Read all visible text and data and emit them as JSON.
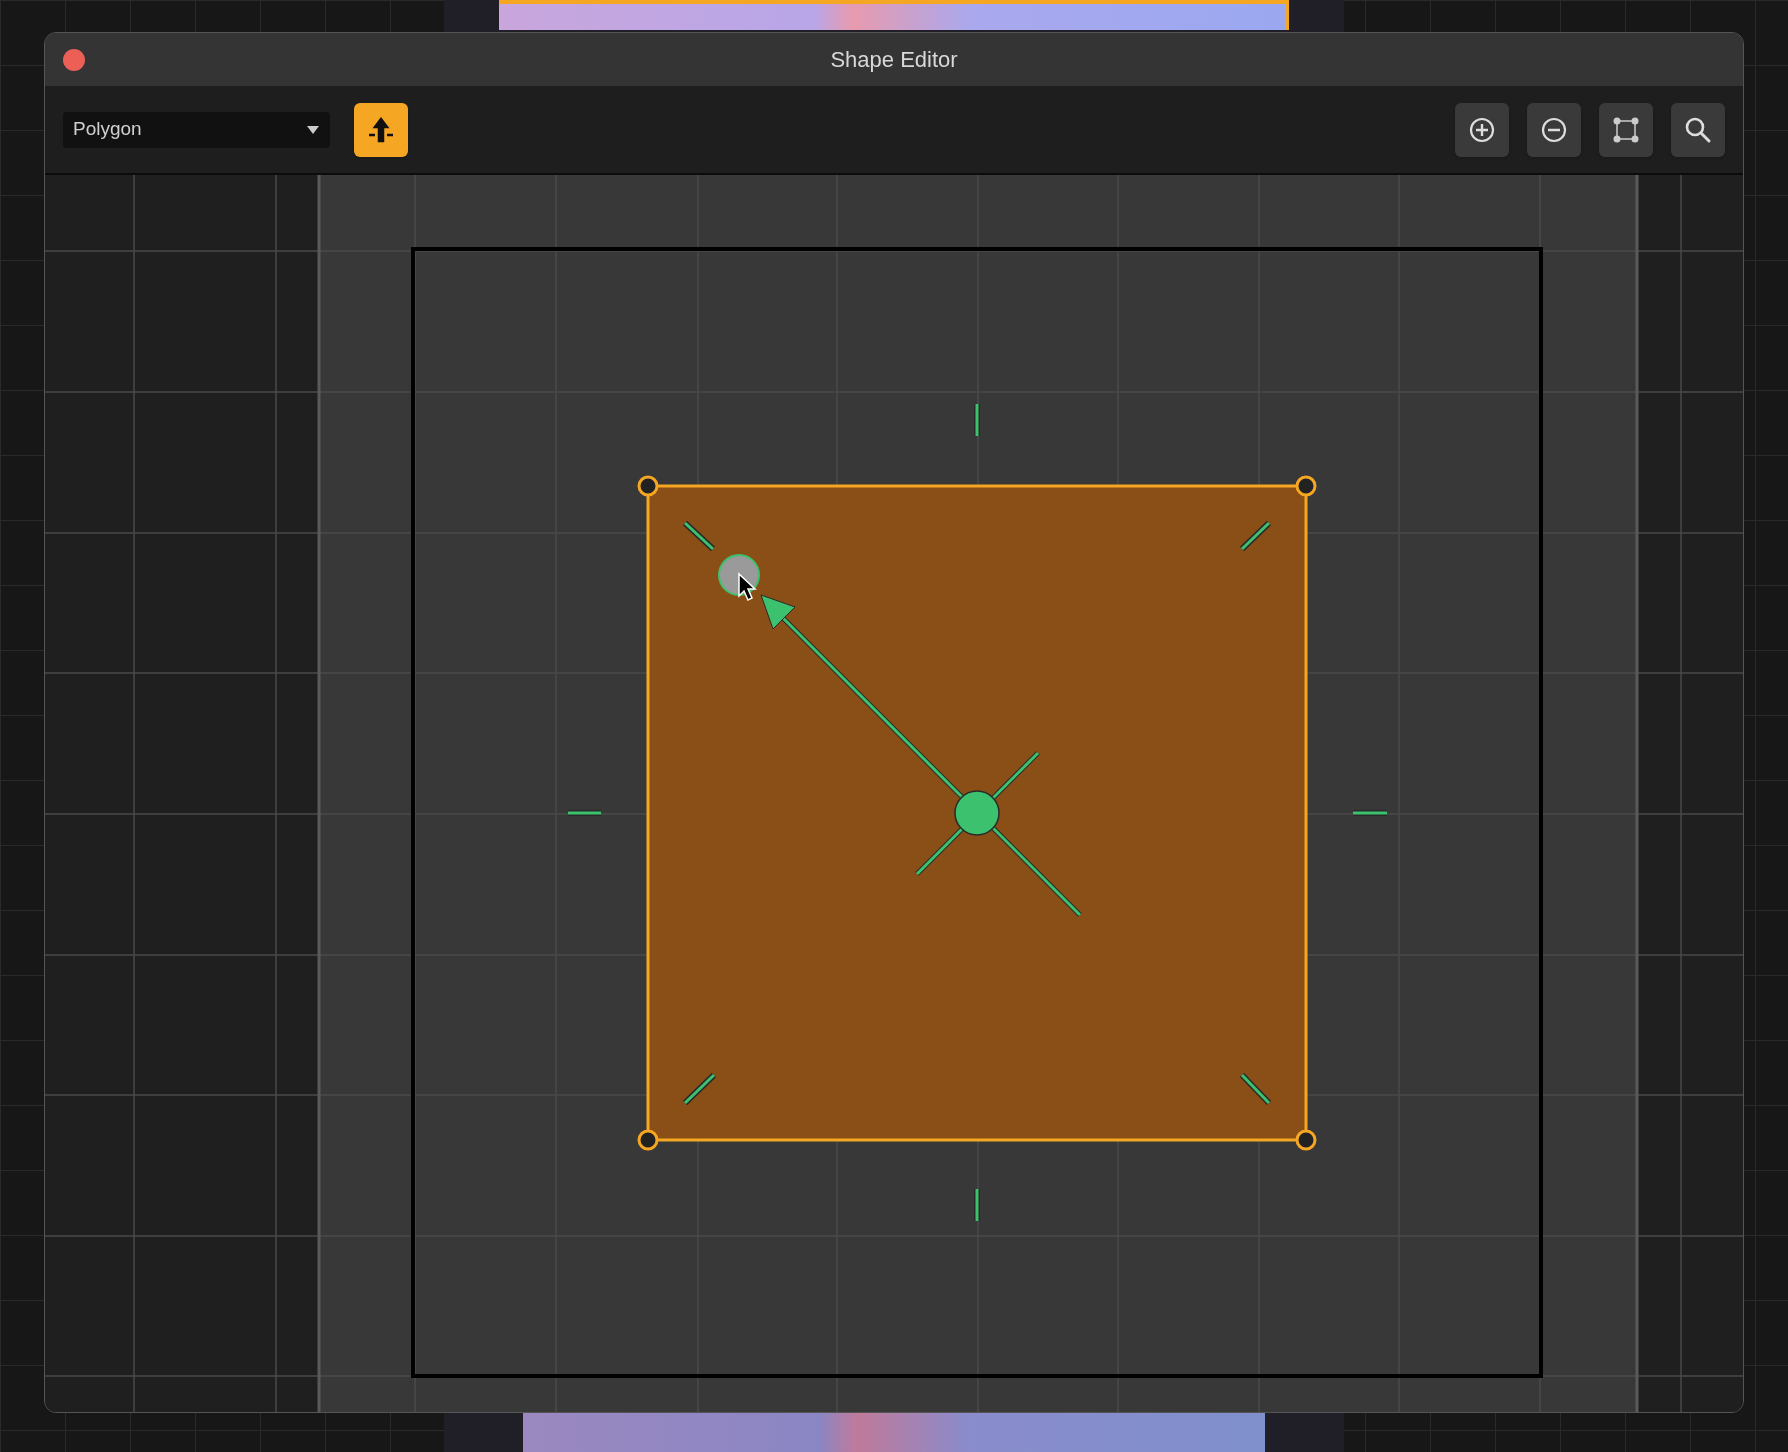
{
  "window": {
    "title": "Shape Editor"
  },
  "toolbar": {
    "shape_type": "Polygon",
    "tools": [
      {
        "kind": "anchor",
        "selected": true
      },
      {
        "kind": "zoom_in",
        "selected": false
      },
      {
        "kind": "zoom_out",
        "selected": false
      },
      {
        "kind": "fit",
        "selected": false
      },
      {
        "kind": "search",
        "selected": false
      }
    ]
  }
}
